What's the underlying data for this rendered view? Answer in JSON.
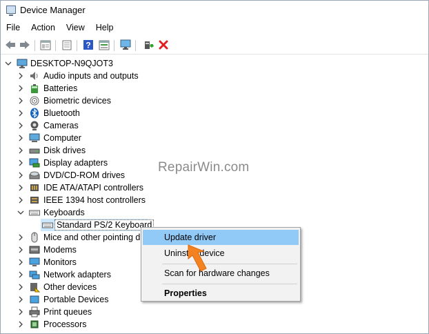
{
  "window": {
    "title": "Device Manager"
  },
  "menu": [
    "File",
    "Action",
    "View",
    "Help"
  ],
  "toolbar": {
    "buttons": [
      "back-icon",
      "forward-icon",
      "properties-view-icon",
      "show-hide-tree-icon",
      "help-icon",
      "details-icon",
      "monitor-scan-icon",
      "update-driver-icon",
      "uninstall-icon"
    ]
  },
  "tree": {
    "root": "DESKTOP-N9QJOT3",
    "categories": [
      "Audio inputs and outputs",
      "Batteries",
      "Biometric devices",
      "Bluetooth",
      "Cameras",
      "Computer",
      "Disk drives",
      "Display adapters",
      "DVD/CD-ROM drives",
      "IDE ATA/ATAPI controllers",
      "IEEE 1394 host controllers",
      "Keyboards",
      "Mice and other pointing d",
      "Modems",
      "Monitors",
      "Network adapters",
      "Other devices",
      "Portable Devices",
      "Print queues",
      "Processors"
    ],
    "keyboard_child": "Standard PS/2 Keyboard"
  },
  "context_menu": {
    "items": [
      "Update driver",
      "Uninstall device",
      "Scan for hardware changes",
      "Properties"
    ]
  },
  "watermark": "RepairWin.com",
  "colors": {
    "hover": "#91c9f7",
    "selection": "#cce8ff",
    "arrow": "#f58220",
    "uninstall": "#e02020",
    "help": "#2b57c7"
  }
}
